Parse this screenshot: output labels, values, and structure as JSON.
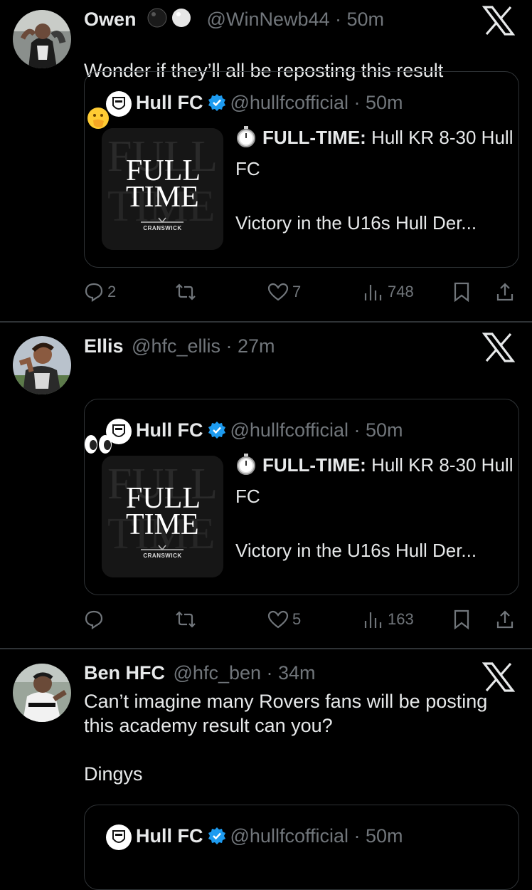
{
  "tweets": [
    {
      "author": "Owen",
      "author_suffix": "⚫️⚪️",
      "handle": "@WinNewb44",
      "time": "50m",
      "text": "Wonder if they’ll all be reposting this result",
      "text_emoji": "🤭",
      "quote": {
        "name": "Hull FC",
        "handle": "@hullfcofficial",
        "time": "50m",
        "headline": "FULL-TIME:",
        "line": " Hull KR 8-30 Hull FC",
        "line2": "Victory in the U16s Hull Der...",
        "image_title_1": "FULL",
        "image_title_2": "TIME",
        "image_sponsor": "CRANSWICK"
      },
      "replies": "2",
      "reposts": "",
      "likes": "7",
      "views": "748"
    },
    {
      "author": "Ellis",
      "handle": "@hfc_ellis",
      "time": "27m",
      "text": "👀",
      "quote": {
        "name": "Hull FC",
        "handle": "@hullfcofficial",
        "time": "50m",
        "headline": "FULL-TIME:",
        "line": " Hull KR 8-30 Hull FC",
        "line2": "Victory in the U16s Hull Der...",
        "image_title_1": "FULL",
        "image_title_2": "TIME",
        "image_sponsor": "CRANSWICK"
      },
      "replies": "",
      "reposts": "",
      "likes": "5",
      "views": "163"
    },
    {
      "author": "Ben HFC",
      "handle": "@hfc_ben",
      "time": "34m",
      "text": "Can’t imagine many Rovers fans will be posting this academy result can you?\n\nDingys",
      "quote": {
        "name": "Hull FC",
        "handle": "@hullfcofficial",
        "time": "50m"
      }
    }
  ],
  "colors": {
    "background": "#000000",
    "text": "#e7e9ea",
    "muted": "#71767b",
    "border": "#2f3336",
    "verified": "#1d9bf0"
  }
}
